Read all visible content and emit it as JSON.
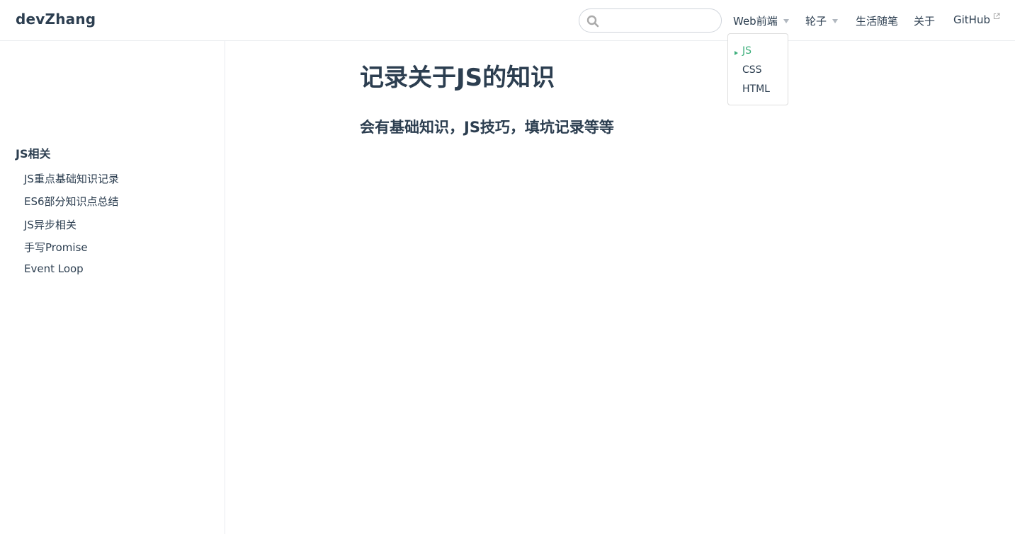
{
  "site": {
    "brand": "devZhang"
  },
  "search": {
    "placeholder": "",
    "value": ""
  },
  "nav": {
    "items": [
      {
        "label": "Web前端",
        "has_dropdown": true
      },
      {
        "label": "轮子",
        "has_dropdown": true
      },
      {
        "label": "生活随笔"
      },
      {
        "label": "关于"
      },
      {
        "label": "GitHub",
        "external": true
      }
    ],
    "dropdown": {
      "items": [
        {
          "label": "JS",
          "active": true
        },
        {
          "label": "CSS"
        },
        {
          "label": "HTML"
        }
      ]
    }
  },
  "sidebar": {
    "heading": "JS相关",
    "links": [
      "JS重点基础知识记录",
      "ES6部分知识点总结",
      "JS异步相关",
      "手写Promise",
      "Event Loop"
    ]
  },
  "main": {
    "title": "记录关于JS的知识",
    "subtitle": "会有基础知识，JS技巧，填坑记录等等"
  },
  "colors": {
    "accent": "#3eaf7c",
    "text": "#2c3e50",
    "border": "#eaecef"
  },
  "icons": {
    "search": "search-icon",
    "external": "external-link-icon",
    "caret": "caret-down-icon"
  }
}
